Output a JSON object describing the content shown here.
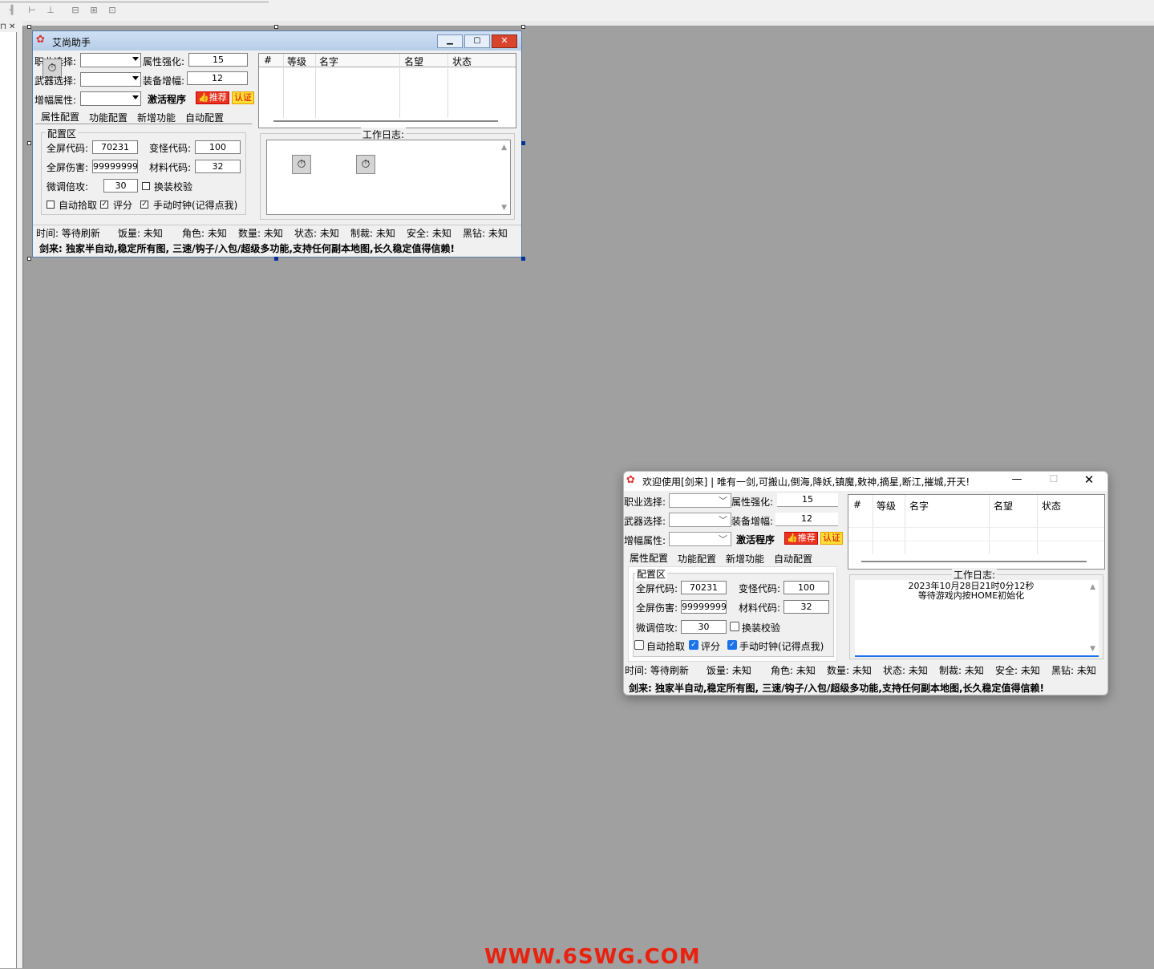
{
  "design_window": {
    "title": "艾尚助手",
    "labels": {
      "job": "职业选择:",
      "weapon": "武器选择:",
      "amp_attr": "增幅属性:",
      "attr_enhance": "属性强化:",
      "equip_amp": "装备增幅:",
      "activate": "激活程序"
    },
    "values": {
      "attr_enhance": "15",
      "equip_amp": "12"
    },
    "buttons": {
      "recommend": "推荐",
      "auth": "认证"
    },
    "list_headers": [
      "#",
      "等级",
      "名字",
      "名望",
      "状态"
    ],
    "tabs": [
      "属性配置",
      "功能配置",
      "新增功能",
      "自动配置"
    ],
    "config": {
      "group_title": "配置区",
      "fullscreen_code_label": "全屏代码:",
      "fullscreen_code": "70231",
      "monster_code_label": "变怪代码:",
      "monster_code": "100",
      "fullscreen_damage_label": "全屏伤害:",
      "fullscreen_damage": "99999999",
      "material_code_label": "材料代码:",
      "material_code": "32",
      "fine_tune_label": "微调倍攻:",
      "fine_tune": "30",
      "swap_check_label": "换装校验",
      "auto_pickup_label": "自动拾取",
      "score_label": "评分",
      "manual_clock_label": "手动时钟(记得点我)"
    },
    "log_title": "工作日志:",
    "status": [
      "时间: 等待刷新",
      "饭量: 未知",
      "角色: 未知",
      "数量: 未知",
      "状态: 未知",
      "制裁: 未知",
      "安全: 未知",
      "黑钻: 未知"
    ],
    "banner": "剑来: 独家半自动,稳定所有图, 三速/钩子/入包/超级多功能,支持任何副本地图,长久稳定值得信赖!"
  },
  "runtime_window": {
    "title": "欢迎使用[剑来] | 唯有一剑,可搬山,倒海,降妖,镇魔,敕神,摘星,断江,摧城,开天!",
    "labels": {
      "job": "职业选择:",
      "weapon": "武器选择:",
      "amp_attr": "增幅属性:",
      "attr_enhance": "属性强化:",
      "equip_amp": "装备增幅:",
      "activate": "激活程序"
    },
    "values": {
      "attr_enhance": "15",
      "equip_amp": "12"
    },
    "buttons": {
      "recommend": "推荐",
      "auth": "认证"
    },
    "list_headers": [
      "#",
      "等级",
      "名字",
      "名望",
      "状态"
    ],
    "tabs": [
      "属性配置",
      "功能配置",
      "新增功能",
      "自动配置"
    ],
    "config": {
      "group_title": "配置区",
      "fullscreen_code_label": "全屏代码:",
      "fullscreen_code": "70231",
      "monster_code_label": "变怪代码:",
      "monster_code": "100",
      "fullscreen_damage_label": "全屏伤害:",
      "fullscreen_damage": "99999999",
      "material_code_label": "材料代码:",
      "material_code": "32",
      "fine_tune_label": "微调倍攻:",
      "fine_tune": "30",
      "swap_check_label": "换装校验",
      "auto_pickup_label": "自动拾取",
      "score_label": "评分",
      "manual_clock_label": "手动时钟(记得点我)"
    },
    "log_title": "工作日志:",
    "log_lines": [
      "2023年10月28日21时0分12秒",
      "等待游戏内按HOME初始化"
    ],
    "status": [
      "时间: 等待刷新",
      "饭量: 未知",
      "角色: 未知",
      "数量: 未知",
      "状态: 未知",
      "制裁: 未知",
      "安全: 未知",
      "黑钻: 未知"
    ],
    "banner": "剑来: 独家半自动,稳定所有图, 三速/钩子/入包/超级多功能,支持任何副本地图,长久稳定值得信赖!"
  },
  "watermark": "WWW.6SWG.COM"
}
